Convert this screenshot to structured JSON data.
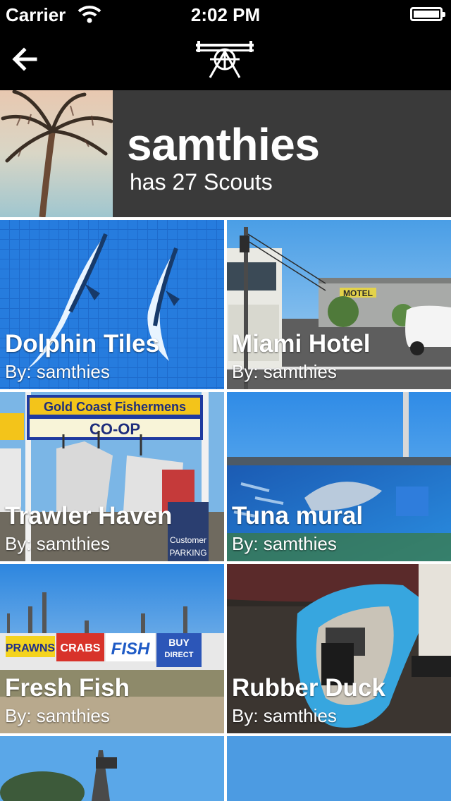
{
  "status_bar": {
    "carrier": "Carrier",
    "time": "2:02 PM"
  },
  "nav": {
    "back_icon": "back-arrow-icon",
    "logo_icon": "scout-tower-logo"
  },
  "profile": {
    "username": "samthies",
    "subtitle": "has 27 Scouts"
  },
  "scouts": [
    {
      "title": "Dolphin Tiles",
      "byline": "By: samthies"
    },
    {
      "title": "Miami Hotel",
      "byline": "By: samthies",
      "sign_text": "MOTEL"
    },
    {
      "title": "Trawler Haven",
      "byline": "By: samthies",
      "sign_top": "Gold Coast Fishermens",
      "sign_main": "CO-OP",
      "sign_side_1": "Customer",
      "sign_side_2": "PARKING"
    },
    {
      "title": "Tuna mural",
      "byline": "By: samthies"
    },
    {
      "title": "Fresh Fish",
      "byline": "By: samthies",
      "sign_1": "PRAWNS",
      "sign_2": "CRABS",
      "sign_3": "FISH",
      "sign_4": "BUY",
      "sign_5": "DIRECT"
    },
    {
      "title": "Rubber Duck",
      "byline": "By: samthies"
    }
  ]
}
